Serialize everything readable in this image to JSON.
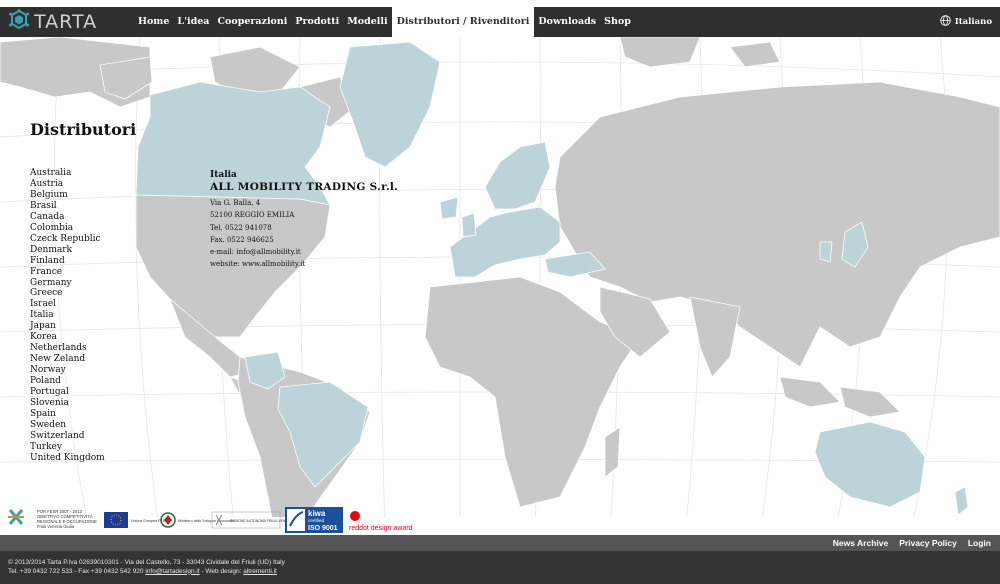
{
  "brand": {
    "name": "TARTA"
  },
  "nav": {
    "items": [
      {
        "label": "Home"
      },
      {
        "label": "L'idea"
      },
      {
        "label": "Cooperazioni"
      },
      {
        "label": "Prodotti"
      },
      {
        "label": "Modelli"
      },
      {
        "label": "Distributori / Rivenditori",
        "active": true
      },
      {
        "label": "Downloads"
      },
      {
        "label": "Shop"
      }
    ],
    "language": "Italiano"
  },
  "page": {
    "title": "Distributori"
  },
  "countries": [
    "Australia",
    "Austria",
    "Belgium",
    "Brasil",
    "Canada",
    "Colombia",
    "Czeck Republic",
    "Denmark",
    "Finland",
    "France",
    "Germany",
    "Greece",
    "Israel",
    "Italia",
    "Japan",
    "Korea",
    "Netherlands",
    "New Zeland",
    "Norway",
    "Poland",
    "Portugal",
    "Slovenia",
    "Spain",
    "Sweden",
    "Switzerland",
    "Turkey",
    "United Kingdom"
  ],
  "distributor": {
    "country": "Italia",
    "name": "ALL MOBILITY TRADING S.r.l.",
    "address": "Via G. Balla, 4",
    "city": "52100 REGGIO EMILIA",
    "tel": "Tel. 0522 941078",
    "fax": "Fax. 0522 946625",
    "email": "e-mail: info@allmobility.it",
    "website": "website: www.allmobility.it"
  },
  "logos": {
    "por_fesr_lines": [
      "POR FESR 2007 - 2013",
      "OBIETTIVO COMPETITIVITÀ",
      "REGIONALE E OCCUPAZIONE",
      "Friuli Venezia Giulia"
    ],
    "eu_label": "Unione Europea FESR",
    "ministry_label": "Ministero dello Sviluppo Economico",
    "region_label": "REGIONE AUTONOMA FRIULI VENEZIA GIULIA",
    "kiwa_top": "kiwa",
    "kiwa_mid": "certified",
    "kiwa_iso": "ISO 9001",
    "reddot": "reddot design award"
  },
  "footer": {
    "links": [
      "News Archive",
      "Privacy Policy",
      "Login"
    ],
    "line1": "© 2013/2014 Tarta P.Iva 02639010301 - Via del Castello, 73 - 33043 Cividale del Friuli (UD) Italy",
    "line2_prefix": "Tel. +39 0432 722 533 - Fax +39 0432 542 920 ",
    "email": "info@tartadesign.it",
    "line2_mid": " - Web design: ",
    "webdesign": "altrementi.it"
  },
  "colors": {
    "navbar": "#2f2f2f",
    "land": "#c8c8c8",
    "highlight": "#bcd3d9",
    "footer_nav": "#555555",
    "footer": "#333333"
  }
}
